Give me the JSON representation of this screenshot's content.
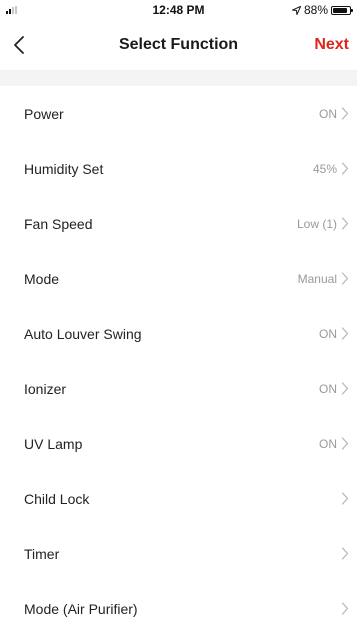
{
  "status_bar": {
    "time": "12:48 PM",
    "battery": "88%",
    "battery_level": 0.88,
    "location_icon": "location-arrow-icon",
    "signal_icon": "cellular-signal-icon"
  },
  "nav": {
    "back_icon": "chevron-left-icon",
    "title": "Select Function",
    "next_label": "Next",
    "accent_color": "#e0261c"
  },
  "functions": [
    {
      "label": "Power",
      "value": "ON"
    },
    {
      "label": "Humidity Set",
      "value": "45%"
    },
    {
      "label": "Fan Speed",
      "value": "Low (1)"
    },
    {
      "label": "Mode",
      "value": "Manual"
    },
    {
      "label": "Auto Louver Swing",
      "value": "ON"
    },
    {
      "label": "Ionizer",
      "value": "ON"
    },
    {
      "label": "UV Lamp",
      "value": "ON"
    },
    {
      "label": "Child Lock",
      "value": ""
    },
    {
      "label": "Timer",
      "value": ""
    },
    {
      "label": "Mode (Air Purifier)",
      "value": ""
    }
  ]
}
